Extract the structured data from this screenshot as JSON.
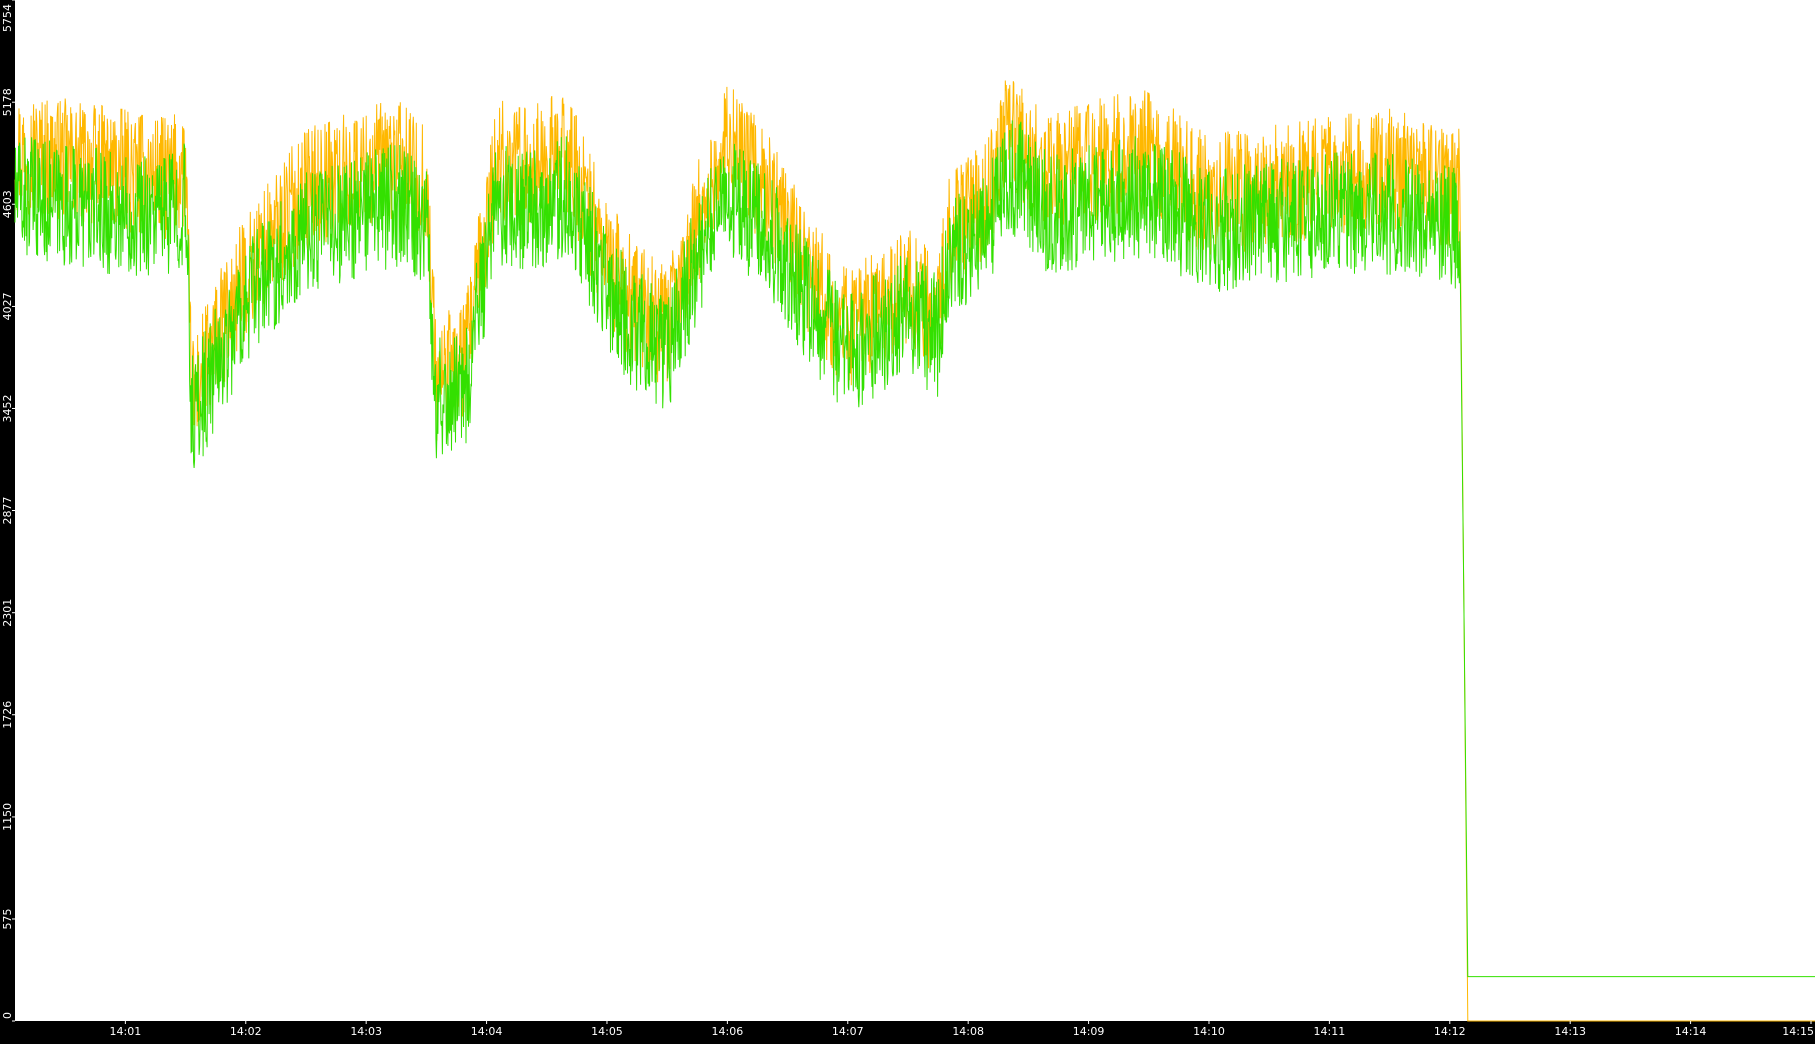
{
  "chart_data": {
    "type": "line",
    "title": "",
    "xlabel": "",
    "ylabel": "",
    "ylim": [
      0,
      5754
    ],
    "xlim": [
      "14:00:05",
      "14:15:02"
    ],
    "grid": false,
    "legend": "none",
    "background": "#ffffff",
    "frame_color": "#000000",
    "y_ticks": [
      0,
      575,
      1150,
      1726,
      2301,
      2877,
      3452,
      4027,
      4603,
      5178,
      5754
    ],
    "x_ticks": [
      "14:01",
      "14:02",
      "14:03",
      "14:04",
      "14:05",
      "14:06",
      "14:07",
      "14:08",
      "14:09",
      "14:10",
      "14:11",
      "14:12",
      "14:13",
      "14:14",
      "14:15"
    ],
    "series": [
      {
        "color": "#ffb800",
        "x": [
          "14:00:05",
          "14:00:30",
          "14:00:55",
          "14:01:20",
          "14:01:30",
          "14:01:33",
          "14:01:40",
          "14:02:00",
          "14:02:30",
          "14:03:00",
          "14:03:15",
          "14:03:30",
          "14:03:35",
          "14:03:50",
          "14:04:05",
          "14:04:20",
          "14:04:40",
          "14:05:00",
          "14:05:10",
          "14:05:30",
          "14:05:45",
          "14:06:00",
          "14:06:20",
          "14:06:40",
          "14:07:00",
          "14:07:30",
          "14:07:45",
          "14:07:50",
          "14:08:10",
          "14:08:20",
          "14:08:40",
          "14:09:00",
          "14:09:30",
          "14:10:00",
          "14:10:30",
          "14:11:00",
          "14:11:30",
          "14:12:00",
          "14:12:05",
          "14:12:07",
          "14:12:09",
          "14:15:02"
        ],
        "y": [
          4900,
          4850,
          4800,
          4750,
          4800,
          3500,
          3700,
          4200,
          4700,
          4800,
          4850,
          4700,
          3600,
          3750,
          4850,
          4800,
          4900,
          4300,
          4100,
          3900,
          4500,
          4950,
          4700,
          4200,
          3900,
          4150,
          3950,
          4450,
          4650,
          5050,
          4750,
          4850,
          4900,
          4650,
          4700,
          4750,
          4800,
          4700,
          4700,
          2400,
          0,
          0
        ]
      },
      {
        "color": "#33e000",
        "x": [
          "14:00:05",
          "14:00:30",
          "14:00:55",
          "14:01:20",
          "14:01:30",
          "14:01:33",
          "14:01:40",
          "14:02:00",
          "14:02:30",
          "14:03:00",
          "14:03:15",
          "14:03:30",
          "14:03:35",
          "14:03:50",
          "14:04:05",
          "14:04:20",
          "14:04:40",
          "14:05:00",
          "14:05:10",
          "14:05:30",
          "14:05:45",
          "14:06:00",
          "14:06:20",
          "14:06:40",
          "14:07:00",
          "14:07:30",
          "14:07:45",
          "14:07:50",
          "14:08:10",
          "14:08:20",
          "14:08:40",
          "14:09:00",
          "14:09:30",
          "14:10:00",
          "14:10:30",
          "14:11:00",
          "14:11:30",
          "14:12:00",
          "14:12:05",
          "14:12:07",
          "14:12:09",
          "14:15:02"
        ],
        "y": [
          4650,
          4600,
          4550,
          4550,
          4600,
          3400,
          3550,
          4050,
          4450,
          4550,
          4600,
          4500,
          3500,
          3600,
          4600,
          4550,
          4650,
          4150,
          3950,
          3750,
          4300,
          4650,
          4450,
          4050,
          3750,
          4000,
          3850,
          4300,
          4450,
          4800,
          4550,
          4600,
          4650,
          4450,
          4500,
          4550,
          4550,
          4500,
          4450,
          2400,
          250,
          250
        ]
      }
    ]
  }
}
